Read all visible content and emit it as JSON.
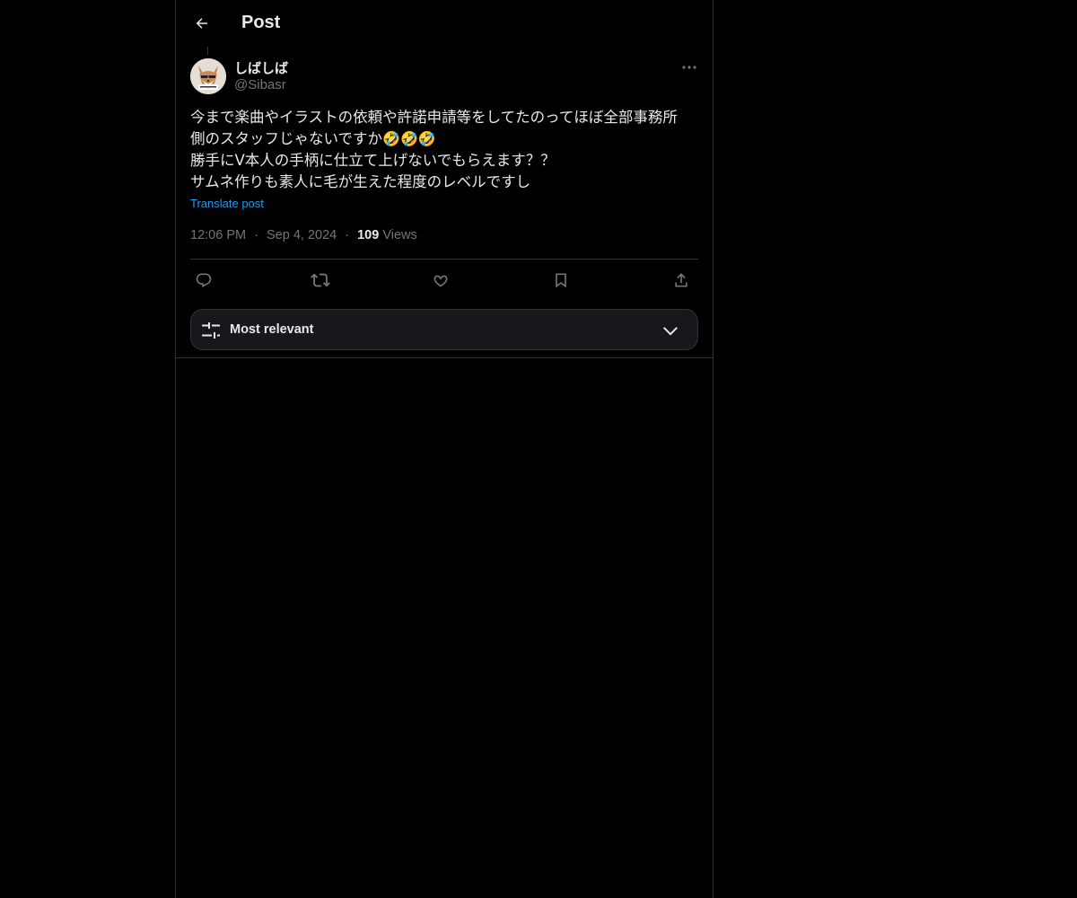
{
  "header": {
    "title": "Post",
    "back_icon": "arrow-left-icon"
  },
  "author": {
    "display_name": "しばしば",
    "handle": "@Sibasr",
    "avatar_icon": "fox-avatar"
  },
  "post": {
    "lines": [
      "今まで楽曲やイラストの依頼や許諾申請等をしてたのってほぼ全部事務所",
      "側のスタッフじゃないですか",
      "勝手にV本人の手柄に仕立て上げないでもらえます？？",
      "サムネ作りも素人に毛が生えた程度のレベルですし"
    ],
    "emoji": "🤣🤣🤣",
    "translate_label": "Translate post",
    "time": "12:06 PM",
    "date": "Sep 4, 2024",
    "separator": "·",
    "views_count": "109",
    "views_label": "Views"
  },
  "actions": {
    "icons": [
      "reply-icon",
      "repost-icon",
      "like-icon",
      "bookmark-icon",
      "share-icon"
    ]
  },
  "sort": {
    "label": "Most relevant",
    "icon": "sliders-icon",
    "chevron": "chevron-down-icon"
  },
  "colors": {
    "background": "#000000",
    "text": "#e7e9ea",
    "secondary": "#71767b",
    "border": "#2f3336",
    "link": "#1d9bf0"
  }
}
